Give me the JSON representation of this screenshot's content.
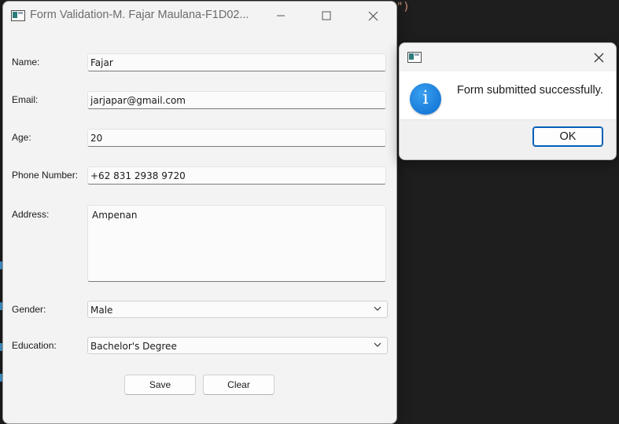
{
  "background_editor": {
    "code_fragment": "\")"
  },
  "main_window": {
    "title": "Form Validation-M. Fajar Maulana-F1D02...",
    "controls": {
      "minimize": "minimize-icon",
      "maximize": "maximize-icon",
      "close": "close-icon"
    },
    "fields": {
      "name": {
        "label": "Name:",
        "value": "Fajar"
      },
      "email": {
        "label": "Email:",
        "value": "jarjapar@gmail.com"
      },
      "age": {
        "label": "Age:",
        "value": "20"
      },
      "phone": {
        "label": "Phone Number:",
        "value": "+62 831 2938 9720"
      },
      "address": {
        "label": "Address:",
        "value": "Ampenan"
      },
      "gender": {
        "label": "Gender:",
        "selected": "Male"
      },
      "education": {
        "label": "Education:",
        "selected": "Bachelor's Degree"
      }
    },
    "buttons": {
      "save": "Save",
      "clear": "Clear"
    }
  },
  "dialog": {
    "title": "",
    "icon": "info-icon",
    "icon_glyph": "i",
    "message": "Form submitted successfully.",
    "ok": "OK"
  },
  "colors": {
    "background": "#1e1e1e",
    "window": "#f3f3f3",
    "accent": "#005fb8",
    "info_icon": "#0a6cd0"
  }
}
